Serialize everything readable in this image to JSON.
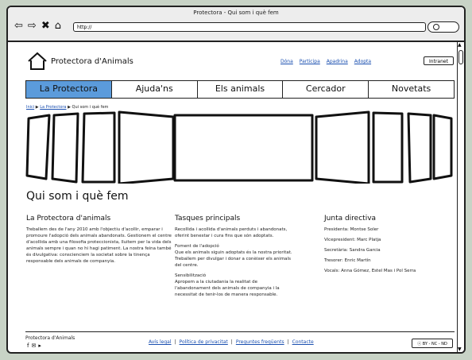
{
  "window": {
    "title": "Protectora - Qui som i què fem",
    "url": "http://"
  },
  "header": {
    "logo_text": "Protectora d'Animals",
    "top_links": [
      "Dóna",
      "Participa",
      "Apadrina",
      "Adopta"
    ],
    "intranet_label": "Intranet"
  },
  "nav": {
    "items": [
      "La Protectora",
      "Ajuda'ns",
      "Els animals",
      "Cercador",
      "Novetats"
    ],
    "active_index": 0,
    "active_color": "#5b9bdb"
  },
  "breadcrumb": {
    "items": [
      "Inici",
      "La Protectora",
      "Qui som i què fem"
    ]
  },
  "page_title": "Qui som i què fem",
  "columns": {
    "about": {
      "heading": "La Protectora d'animals",
      "text": "Treballem des de l'any 2010 amb l'objectiu d'acollir, emparar i promoure l'adopció dels animals abandonats. Gestionem el centre d'acollida amb una filosofia proteccionista, lluitem per la vida dels animals sempre i quan no hi hagi patiment. La nostra feina també és divulgativa: conscienciem la societat sobre la tinença responsable dels animals de companyia."
    },
    "tasks": {
      "heading": "Tasques principals",
      "paragraphs": [
        "Recollida i acollida d'animals perduts i abandonats, oferint benestar i cura fins que són adoptats.",
        "Foment de l'adopció\nQue els animals siguin adoptats és la nostra prioritat. Treballem per divulgar i donar a conèixer els animals del centre.",
        "Sensibilització\nApropem a la ciutadania la realitat de l'abandonament dels animals de companyia i la necessitat de tenir-los de manera responsable."
      ]
    },
    "board": {
      "heading": "Junta directiva",
      "members": [
        "Presidenta: Montse Soler",
        "Vicepresident: Marc Platja",
        "Secretària: Sandra Garcia",
        "Tresorer: Enric Martín",
        "Vocals: Anna Gómez, Estel Mas i Pol Serra"
      ]
    }
  },
  "footer": {
    "brand": "Protectora d'Animals",
    "social_icons": [
      "facebook-icon",
      "twitter-icon",
      "youtube-icon"
    ],
    "links": [
      "Avís legal",
      "Política de privacitat",
      "Preguntes freqüents",
      "Contacte"
    ],
    "license": "BY - NC - ND"
  }
}
